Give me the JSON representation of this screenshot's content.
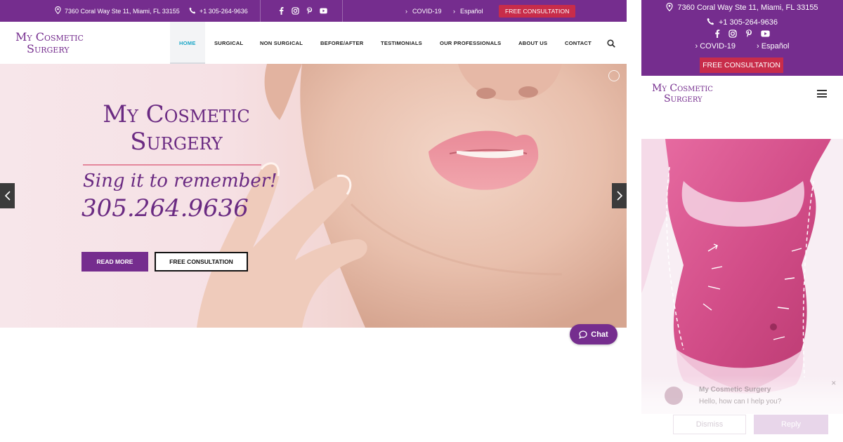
{
  "desktop": {
    "topbar": {
      "address": "7360 Coral Way Ste 11, Miami, FL 33155",
      "phone": "+1 305-264-9636",
      "social_icons": [
        "facebook-icon",
        "instagram-icon",
        "pinterest-icon",
        "youtube-icon"
      ],
      "covid": "COVID-19",
      "espanol": "Español",
      "consult": "FREE CONSULTATION"
    },
    "logo": {
      "line1": "My Cosmetic",
      "line2": "Surgery"
    },
    "nav": [
      {
        "label": "HOME",
        "active": true
      },
      {
        "label": "SURGICAL"
      },
      {
        "label": "NON SURGICAL"
      },
      {
        "label": "BEFORE/AFTER"
      },
      {
        "label": "TESTIMONIALS"
      },
      {
        "label": "OUR PROFESSIONALS"
      },
      {
        "label": "ABOUT US"
      },
      {
        "label": "CONTACT"
      }
    ],
    "hero": {
      "title_line1": "My Cosmetic",
      "title_line2": "Surgery",
      "tagline": "Sing it to remember!",
      "phone": "305.264.9636",
      "read_more": "READ MORE",
      "consult": "FREE CONSULTATION"
    },
    "chat_label": "Chat"
  },
  "mobile": {
    "address": "7360 Coral Way Ste 11, Miami, FL 33155",
    "phone": "+1 305-264-9636",
    "covid": "COVID-19",
    "espanol": "Español",
    "consult": "FREE CONSULTATION",
    "logo": {
      "line1": "My Cosmetic",
      "line2": "Surgery"
    },
    "chat": {
      "name": "My Cosmetic Surgery",
      "message": "Hello, how can I help you?",
      "dismiss": "Dismiss",
      "reply": "Reply"
    }
  },
  "colors": {
    "brand_purple": "#752d8e",
    "cta_red": "#c82c4a",
    "nav_active": "#1aa6c7"
  }
}
